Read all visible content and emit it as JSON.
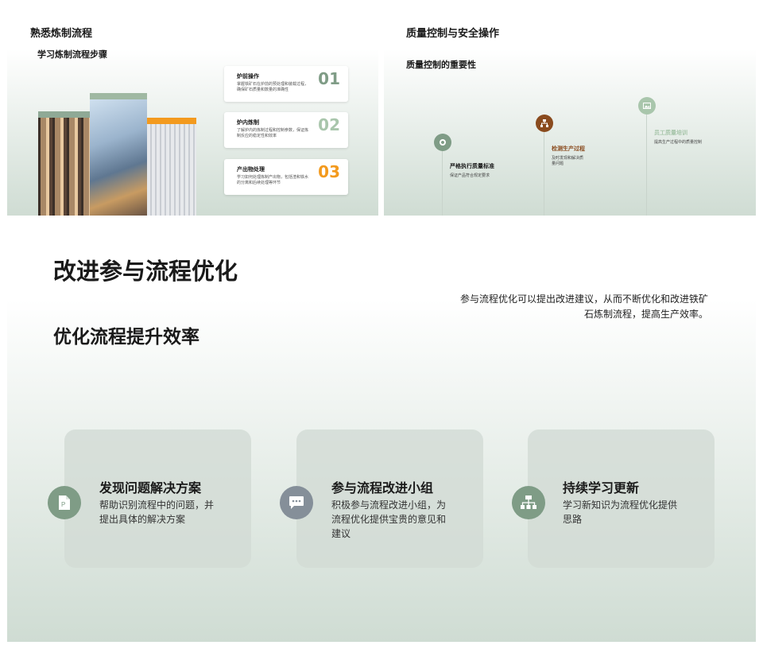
{
  "slide1": {
    "title": "熟悉炼制流程",
    "subtitle": "学习炼制流程步骤",
    "steps": [
      {
        "title": "炉前操作",
        "desc": "掌握铁矿石在炉前的预处理和装载过程，确保矿石质量和数量的准确性",
        "num": "01"
      },
      {
        "title": "炉内炼制",
        "desc": "了解炉内的炼制过程和控制参数，保证炼制反应的稳定性和效率",
        "num": "02"
      },
      {
        "title": "产出物处理",
        "desc": "学习如何处理炼制产出物，包括渣和铁水的分离和后续处理等环节",
        "num": "03"
      }
    ]
  },
  "slide2": {
    "title": "质量控制与安全操作",
    "subtitle": "质量控制的重要性",
    "items": [
      {
        "title": "严格执行质量标准",
        "desc": "保证产品符合规定要求",
        "color": "#7f9c86"
      },
      {
        "title": "检测生产过程",
        "desc": "及时发现和解决质量问题",
        "color": "#8a4b1e"
      },
      {
        "title": "员工质量培训",
        "desc": "提高生产过程中的质量控制",
        "color": "#a9c6ac"
      }
    ]
  },
  "slide3": {
    "title": "改进参与流程优化",
    "subtitle": "优化流程提升效率",
    "desc": "参与流程优化可以提出改进建议，从而不断优化和改进铁矿石炼制流程，提高生产效率。",
    "cards": [
      {
        "title": "发现问题解决方案",
        "desc": "帮助识别流程中的问题，并提出具体的解决方案",
        "icon": "document-icon",
        "color": "#7f9c86"
      },
      {
        "title": "参与流程改进小组",
        "desc": "积极参与流程改进小组，为流程优化提供宝贵的意见和建议",
        "icon": "chat-icon",
        "color": "#858f99"
      },
      {
        "title": "持续学习更新",
        "desc": "学习新知识为流程优化提供思路",
        "icon": "org-chart-icon",
        "color": "#7f9c86"
      }
    ]
  }
}
